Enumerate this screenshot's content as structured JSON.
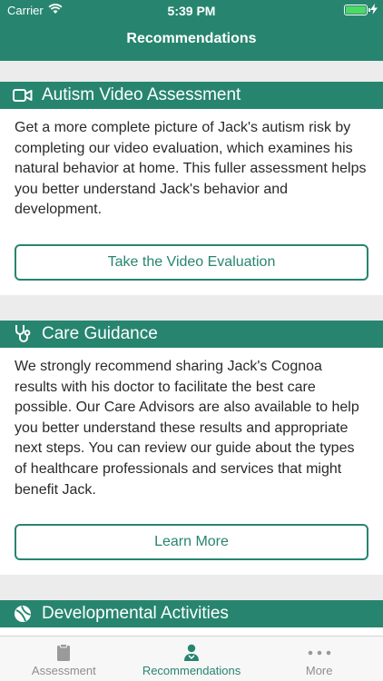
{
  "status_bar": {
    "carrier": "Carrier",
    "time": "5:39 PM"
  },
  "nav": {
    "title": "Recommendations"
  },
  "cards": [
    {
      "title": "Autism Video Assessment",
      "icon": "video-camera-icon",
      "body": "Get a more complete picture of Jack's autism risk by completing our video evaluation, which examines his natural behavior at home. This fuller assessment helps you better understand Jack's behavior and development.",
      "button": "Take the Video Evaluation"
    },
    {
      "title": "Care Guidance",
      "icon": "stethoscope-icon",
      "body": "We strongly recommend sharing Jack's Cognoa results with his doctor to facilitate the best care possible.  Our Care Advisors are also available to help you better understand these results and appropriate next steps.  You can review our guide about the types of healthcare professionals and services that might benefit Jack.",
      "button": "Learn More"
    },
    {
      "title": "Developmental Activities",
      "icon": "ball-icon"
    }
  ],
  "tabs": [
    {
      "label": "Assessment",
      "icon": "clipboard-icon"
    },
    {
      "label": "Recommendations",
      "icon": "person-icon"
    },
    {
      "label": "More",
      "icon": "more-dots-icon"
    }
  ],
  "colors": {
    "brand": "#27856f",
    "battery": "#4cd964"
  }
}
